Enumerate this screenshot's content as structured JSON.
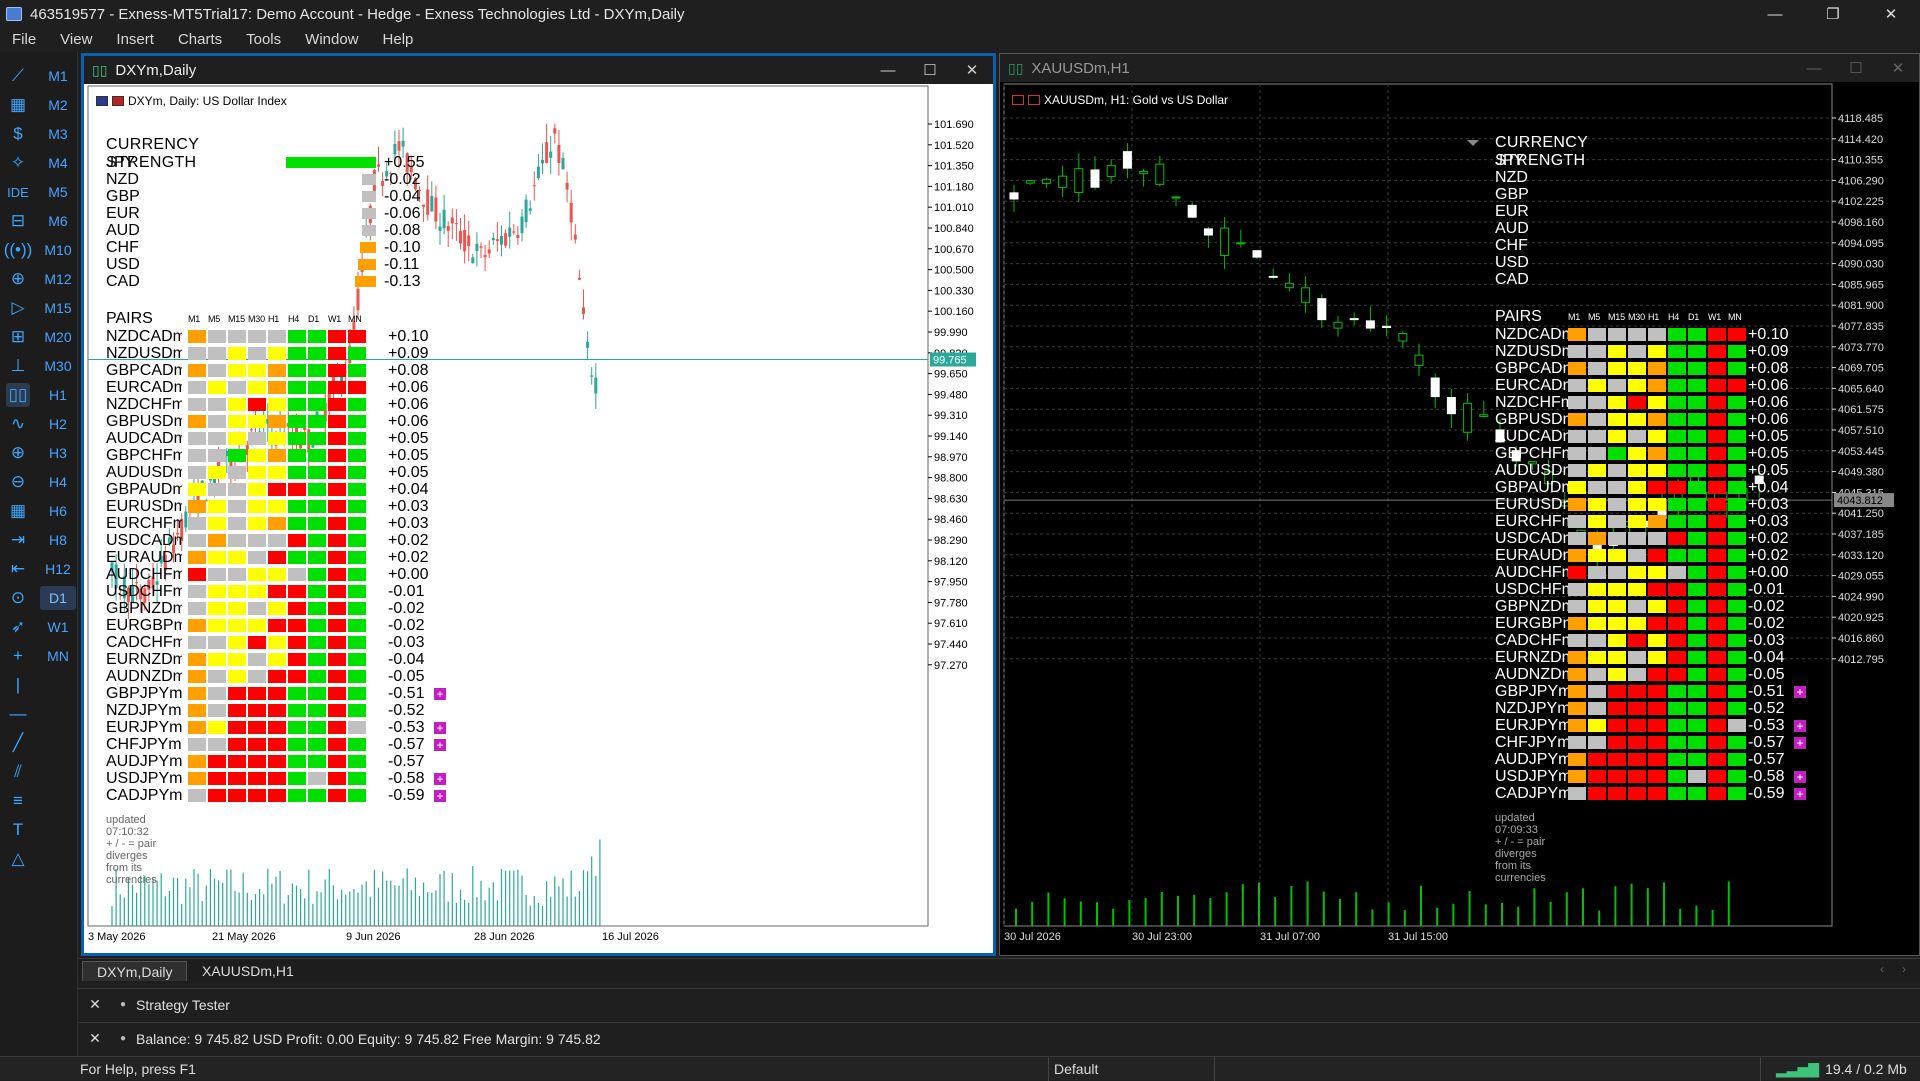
{
  "app": {
    "title": "463519577 - Exness-MT5Trial17: Demo Account - Hedge - Exness Technologies Ltd - DXYm,Daily",
    "window_buttons": {
      "minimize": "—",
      "maximize": "❐",
      "close": "✕"
    }
  },
  "menu": [
    "File",
    "View",
    "Insert",
    "Charts",
    "Tools",
    "Window",
    "Help"
  ],
  "toolbar": {
    "timeframes": [
      "M1",
      "M2",
      "M3",
      "M4",
      "M5",
      "M6",
      "M10",
      "M12",
      "M15",
      "M20",
      "M30",
      "H1",
      "H2",
      "H3",
      "H4",
      "H6",
      "H8",
      "H12",
      "D1",
      "W1",
      "MN"
    ],
    "selected_timeframe": "D1",
    "ide_label": "IDE",
    "icons": [
      "line-chart-icon",
      "candles-icon",
      "dollar-icon",
      "signal-icon",
      "ide-icon",
      "market-icon",
      "radio-icon",
      "globe-icon",
      "play-icon",
      "plus-chart-icon",
      "indicator-icon",
      "bars-icon",
      "oscillator-icon",
      "zoom-in-icon",
      "zoom-out-icon",
      "grid-icon",
      "autoscroll-icon",
      "shift-icon",
      "screenshot-icon",
      "cursor-icon",
      "crosshair-icon",
      "vertical-line-icon",
      "horizontal-line-icon",
      "trend-line-icon",
      "channel-icon",
      "fib-icon",
      "text-icon",
      "shapes-icon"
    ]
  },
  "dxy": {
    "window_title": "DXYm,Daily",
    "chart_label": "DXYm, Daily:  US Dollar Index",
    "price_axis": [
      "101.690",
      "101.520",
      "101.350",
      "101.180",
      "101.010",
      "100.840",
      "100.670",
      "100.500",
      "100.330",
      "100.160",
      "99.990",
      "99.820",
      "99.650",
      "99.480",
      "99.310",
      "99.140",
      "98.970",
      "98.800",
      "98.630",
      "98.460",
      "98.290",
      "98.120",
      "97.950",
      "97.780",
      "97.610",
      "97.440",
      "97.270"
    ],
    "current_price": "99.765",
    "dates": [
      "3 May 2026",
      "21 May 2026",
      "9 Jun 2026",
      "28 Jun 2026",
      "16 Jul 2026"
    ],
    "updated": "updated 07:10:32   + / - = pair diverges from its currencies"
  },
  "xau": {
    "window_title": "XAUUSDm,H1",
    "chart_label": "XAUUSDm, H1:  Gold vs US Dollar",
    "price_axis": [
      "4118.485",
      "4114.420",
      "4110.355",
      "4106.290",
      "4102.225",
      "4098.160",
      "4094.095",
      "4090.030",
      "4085.965",
      "4081.900",
      "4077.835",
      "4073.770",
      "4069.705",
      "4065.640",
      "4061.575",
      "4057.510",
      "4053.445",
      "4049.380",
      "4045.315",
      "4041.250",
      "4037.185",
      "4033.120",
      "4029.055",
      "4024.990",
      "4020.925",
      "4016.860",
      "4012.795"
    ],
    "current_price": "4043.812",
    "dates": [
      "30 Jul 2026",
      "30 Jul 23:00",
      "31 Jul 07:00",
      "31 Jul 15:00"
    ],
    "updated": "updated 07:09:33   + / - = pair diverges from its currencies"
  },
  "strength": {
    "title": "CURRENCY STRENGTH",
    "rows": [
      {
        "name": "JPY",
        "value": "+0.55",
        "level": 0.55,
        "color": "#00e000"
      },
      {
        "name": "NZD",
        "value": "-0.02",
        "level": 0.02,
        "color": "#c0c0c0"
      },
      {
        "name": "GBP",
        "value": "-0.04",
        "level": 0.04,
        "color": "#c0c0c0"
      },
      {
        "name": "EUR",
        "value": "-0.06",
        "level": 0.06,
        "color": "#c0c0c0"
      },
      {
        "name": "AUD",
        "value": "-0.08",
        "level": 0.08,
        "color": "#c0c0c0"
      },
      {
        "name": "CHF",
        "value": "-0.10",
        "level": 0.1,
        "color": "#ffa000"
      },
      {
        "name": "USD",
        "value": "-0.11",
        "level": 0.11,
        "color": "#ffa000"
      },
      {
        "name": "CAD",
        "value": "-0.13",
        "level": 0.13,
        "color": "#ffa000"
      }
    ]
  },
  "pairs": {
    "title": "PAIRS",
    "headers": [
      "M1",
      "M5",
      "M15",
      "M30",
      "H1",
      "H4",
      "D1",
      "W1",
      "MN"
    ],
    "colors": {
      "O": "#ffa000",
      "G": "#c0c0c0",
      "Y": "#ffff00",
      "R": "#ff0000",
      "N": "#00e000",
      "D": "#e00000",
      "L": "#00c000"
    },
    "rows": [
      {
        "name": "NZDCADm",
        "value": "+0.10",
        "cells": "OGGGGNNRR",
        "mark": ""
      },
      {
        "name": "NZDUSDm",
        "value": "+0.09",
        "cells": "GGYGYNNRN",
        "mark": ""
      },
      {
        "name": "GBPCADm",
        "value": "+0.08",
        "cells": "OGYYONNRN",
        "mark": ""
      },
      {
        "name": "EURCADm",
        "value": "+0.06",
        "cells": "GYGYONNRR",
        "mark": ""
      },
      {
        "name": "NZDCHFm",
        "value": "+0.06",
        "cells": "GGYRYNNRN",
        "mark": ""
      },
      {
        "name": "GBPUSDm",
        "value": "+0.06",
        "cells": "OGYYONNRN",
        "mark": ""
      },
      {
        "name": "AUDCADm",
        "value": "+0.05",
        "cells": "GGYGYNNRN",
        "mark": ""
      },
      {
        "name": "GBPCHFm",
        "value": "+0.05",
        "cells": "GGNYONNRN",
        "mark": ""
      },
      {
        "name": "AUDUSDm",
        "value": "+0.05",
        "cells": "GYGYYNNRN",
        "mark": ""
      },
      {
        "name": "GBPAUDm",
        "value": "+0.04",
        "cells": "YGGYRRNRN",
        "mark": ""
      },
      {
        "name": "EURUSDm",
        "value": "+0.03",
        "cells": "OYGYYNNRN",
        "mark": ""
      },
      {
        "name": "EURCHFm",
        "value": "+0.03",
        "cells": "GYGYONNRN",
        "mark": ""
      },
      {
        "name": "USDCADm",
        "value": "+0.02",
        "cells": "GOGGGRNRN",
        "mark": ""
      },
      {
        "name": "EURAUDm",
        "value": "+0.02",
        "cells": "OYYGRNNRN",
        "mark": ""
      },
      {
        "name": "AUDCHFm",
        "value": "+0.00",
        "cells": "RGGYYGNRN",
        "mark": ""
      },
      {
        "name": "USDCHFm",
        "value": "-0.01",
        "cells": "GYYYRRNRN",
        "mark": ""
      },
      {
        "name": "GBPNZDm",
        "value": "-0.02",
        "cells": "GYYGYRNRN",
        "mark": ""
      },
      {
        "name": "EURGBPm",
        "value": "-0.02",
        "cells": "OYYYRRNRN",
        "mark": ""
      },
      {
        "name": "CADCHFm",
        "value": "-0.03",
        "cells": "GGYRYRNRN",
        "mark": ""
      },
      {
        "name": "EURNZDm",
        "value": "-0.04",
        "cells": "OYYGYRNRN",
        "mark": ""
      },
      {
        "name": "AUDNZDm",
        "value": "-0.05",
        "cells": "OGYGRRNRN",
        "mark": ""
      },
      {
        "name": "GBPJPYm",
        "value": "-0.51",
        "cells": "OGRRRNNRN",
        "mark": "+"
      },
      {
        "name": "NZDJPYm",
        "value": "-0.52",
        "cells": "OGRRRNNRN",
        "mark": ""
      },
      {
        "name": "EURJPYm",
        "value": "-0.53",
        "cells": "OYRRRNNRG",
        "mark": "+"
      },
      {
        "name": "CHFJPYm",
        "value": "-0.57",
        "cells": "GGRRRNNRN",
        "mark": "+"
      },
      {
        "name": "AUDJPYm",
        "value": "-0.57",
        "cells": "ORRRRNNRN",
        "mark": ""
      },
      {
        "name": "USDJPYm",
        "value": "-0.58",
        "cells": "ORRRRNGRN",
        "mark": "+"
      },
      {
        "name": "CADJPYm",
        "value": "-0.59",
        "cells": "GRRRRNNRN",
        "mark": "+"
      }
    ]
  },
  "tabs": [
    "DXYm,Daily",
    "XAUUSDm,H1"
  ],
  "strategy_tester": "Strategy Tester",
  "balance": "Balance: 9 745.82 USD  Profit: 0.00  Equity: 9 745.82  Free Margin: 9 745.82",
  "status": {
    "help": "For Help, press F1",
    "profile": "Default",
    "network": "19.4 / 0.2 Mb"
  }
}
